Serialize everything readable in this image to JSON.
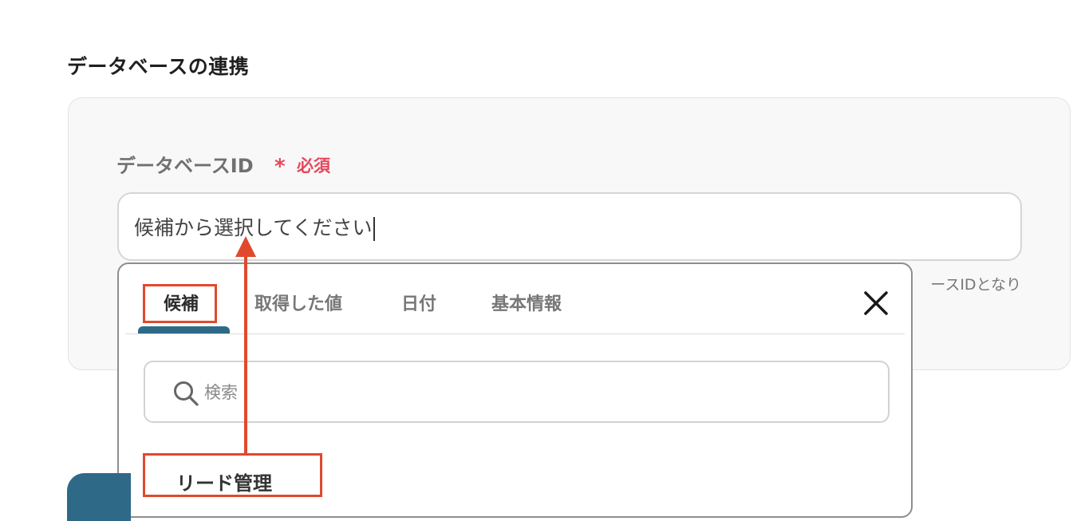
{
  "section": {
    "title": "データベースの連携"
  },
  "field": {
    "label": "データベースID",
    "required_mark": "*",
    "required_text": "必須",
    "input_value": "候補から選択してください",
    "helper_text": "ースIDとなり"
  },
  "popup": {
    "tabs": [
      {
        "label": "候補",
        "active": true
      },
      {
        "label": "取得した値",
        "active": false
      },
      {
        "label": "日付",
        "active": false
      },
      {
        "label": "基本情報",
        "active": false
      }
    ],
    "close_icon": "close-icon",
    "search": {
      "placeholder": "検索",
      "icon": "search-icon"
    },
    "items": [
      {
        "label": "リード管理"
      }
    ]
  },
  "colors": {
    "accent": "#2e6a87",
    "required": "#e5485a",
    "highlight": "#e0492d"
  }
}
